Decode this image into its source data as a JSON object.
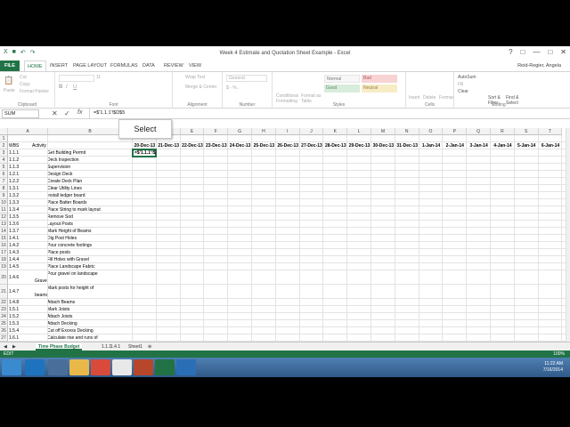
{
  "window": {
    "title": "Week 4 Estimate and Quotation Sheet Example - Excel",
    "controls": [
      "?",
      "□",
      "—",
      "□",
      "✕"
    ]
  },
  "tabs": [
    "HOME",
    "INSERT",
    "PAGE LAYOUT",
    "FORMULAS",
    "DATA",
    "REVIEW",
    "VIEW"
  ],
  "file_tab": "FILE",
  "user": "Reid-Regier, Angela",
  "ribbon": {
    "clipboard": {
      "paste": "Paste",
      "cut": "Cut",
      "copy": "Copy",
      "format_painter": "Format Painter",
      "label": "Clipboard"
    },
    "font": {
      "label": "Font",
      "size": "11"
    },
    "alignment": {
      "wrap": "Wrap Text",
      "merge": "Merge & Center",
      "label": "Alignment"
    },
    "number": {
      "format": "General",
      "symbols": "$ - % ,",
      "label": "Number"
    },
    "styles": {
      "cond": "Conditional Formatting",
      "table": "Format as Table",
      "normal": "Normal",
      "bad": "Bad",
      "good": "Good",
      "neutral": "Neutral",
      "label": "Styles"
    },
    "cells": {
      "insert": "Insert",
      "delete": "Delete",
      "format": "Format",
      "label": "Cells"
    },
    "editing": {
      "autosum": "AutoSum",
      "fill": "Fill",
      "clear": "Clear",
      "sort": "Sort & Filter",
      "find": "Find & Select",
      "label": "Editing"
    }
  },
  "formula_bar": {
    "name_box": "SUM",
    "formula": "=$'1.1.1'!$D$5"
  },
  "tooltip": "Select",
  "columns": [
    "A",
    "B",
    "C",
    "D",
    "E",
    "F",
    "G",
    "H",
    "I",
    "J",
    "K",
    "L",
    "M",
    "N",
    "O",
    "P",
    "Q",
    "R",
    "S",
    "T"
  ],
  "date_headers": [
    "20-Dec-13",
    "21-Dec-13",
    "22-Dec-13",
    "23-Dec-13",
    "24-Dec-13",
    "25-Dec-13",
    "26-Dec-13",
    "27-Dec-13",
    "28-Dec-13",
    "29-Dec-13",
    "30-Dec-13",
    "31-Dec-13",
    "1-Jan-14",
    "2-Jan-14",
    "3-Jan-14",
    "4-Jan-14",
    "5-Jan-14",
    "6-Jan-14",
    "7-J"
  ],
  "header_row": {
    "wbs": "WBS",
    "activity": "Activity"
  },
  "active_cell": "=$'1.1.1'!$",
  "rows": [
    {
      "n": "1",
      "wbs": "",
      "act": ""
    },
    {
      "n": "2",
      "wbs": "WBS",
      "act": "Activity"
    },
    {
      "n": "3",
      "wbs": "1.1.1",
      "act": "Get Building Permit"
    },
    {
      "n": "4",
      "wbs": "1.1.2",
      "act": "Deck Inspection"
    },
    {
      "n": "5",
      "wbs": "1.1.3",
      "act": "Supervision"
    },
    {
      "n": "6",
      "wbs": "1.2.1",
      "act": "Design Deck"
    },
    {
      "n": "7",
      "wbs": "1.2.2",
      "act": "Create Deck Plan"
    },
    {
      "n": "8",
      "wbs": "1.3.1",
      "act": "Clear Utility Lines"
    },
    {
      "n": "9",
      "wbs": "1.3.2",
      "act": "Install ledger board"
    },
    {
      "n": "10",
      "wbs": "1.3.3",
      "act": "Place Batter Boards"
    },
    {
      "n": "11",
      "wbs": "1.3.4",
      "act": "Place String to mark layout"
    },
    {
      "n": "12",
      "wbs": "1.3.5",
      "act": "Remove Sod"
    },
    {
      "n": "13",
      "wbs": "1.3.6",
      "act": "Layout Posts"
    },
    {
      "n": "14",
      "wbs": "1.3.7",
      "act": "Mark Height of Beams"
    },
    {
      "n": "15",
      "wbs": "1.4.1",
      "act": "Dig Post Holes"
    },
    {
      "n": "16",
      "wbs": "1.4.2",
      "act": "Pour concrete footings"
    },
    {
      "n": "17",
      "wbs": "1.4.3",
      "act": "Place posts"
    },
    {
      "n": "18",
      "wbs": "1.4.4",
      "act": "Fill Holes with Gravel"
    },
    {
      "n": "19",
      "wbs": "1.4.5",
      "act": "Place Landscape Fabric"
    },
    {
      "n": "20",
      "wbs": "1.4.6",
      "act": "Pour gravel on landscape",
      "act2": "Gravel"
    },
    {
      "n": "21",
      "wbs": "1.4.7",
      "act": "Mark posts for height of",
      "act2": "beams"
    },
    {
      "n": "22",
      "wbs": "1.4.8",
      "act": "Attach Beams"
    },
    {
      "n": "23",
      "wbs": "1.5.1",
      "act": "Mark Joists"
    },
    {
      "n": "24",
      "wbs": "1.5.2",
      "act": "Attach Joists"
    },
    {
      "n": "25",
      "wbs": "1.5.3",
      "act": "Attach Decking"
    },
    {
      "n": "26",
      "wbs": "1.5.4",
      "act": "Cut off Excess Decking"
    },
    {
      "n": "27",
      "wbs": "1.6.1",
      "act": "Calculate rise and runs of"
    }
  ],
  "sheets": [
    "Time Phase Budget",
    "1.1.1",
    "1.4.1",
    "Sheet1"
  ],
  "status": {
    "mode": "EDIT",
    "zoom": "100%"
  },
  "clock": {
    "time": "11:22 AM",
    "date": "7/16/2014"
  }
}
